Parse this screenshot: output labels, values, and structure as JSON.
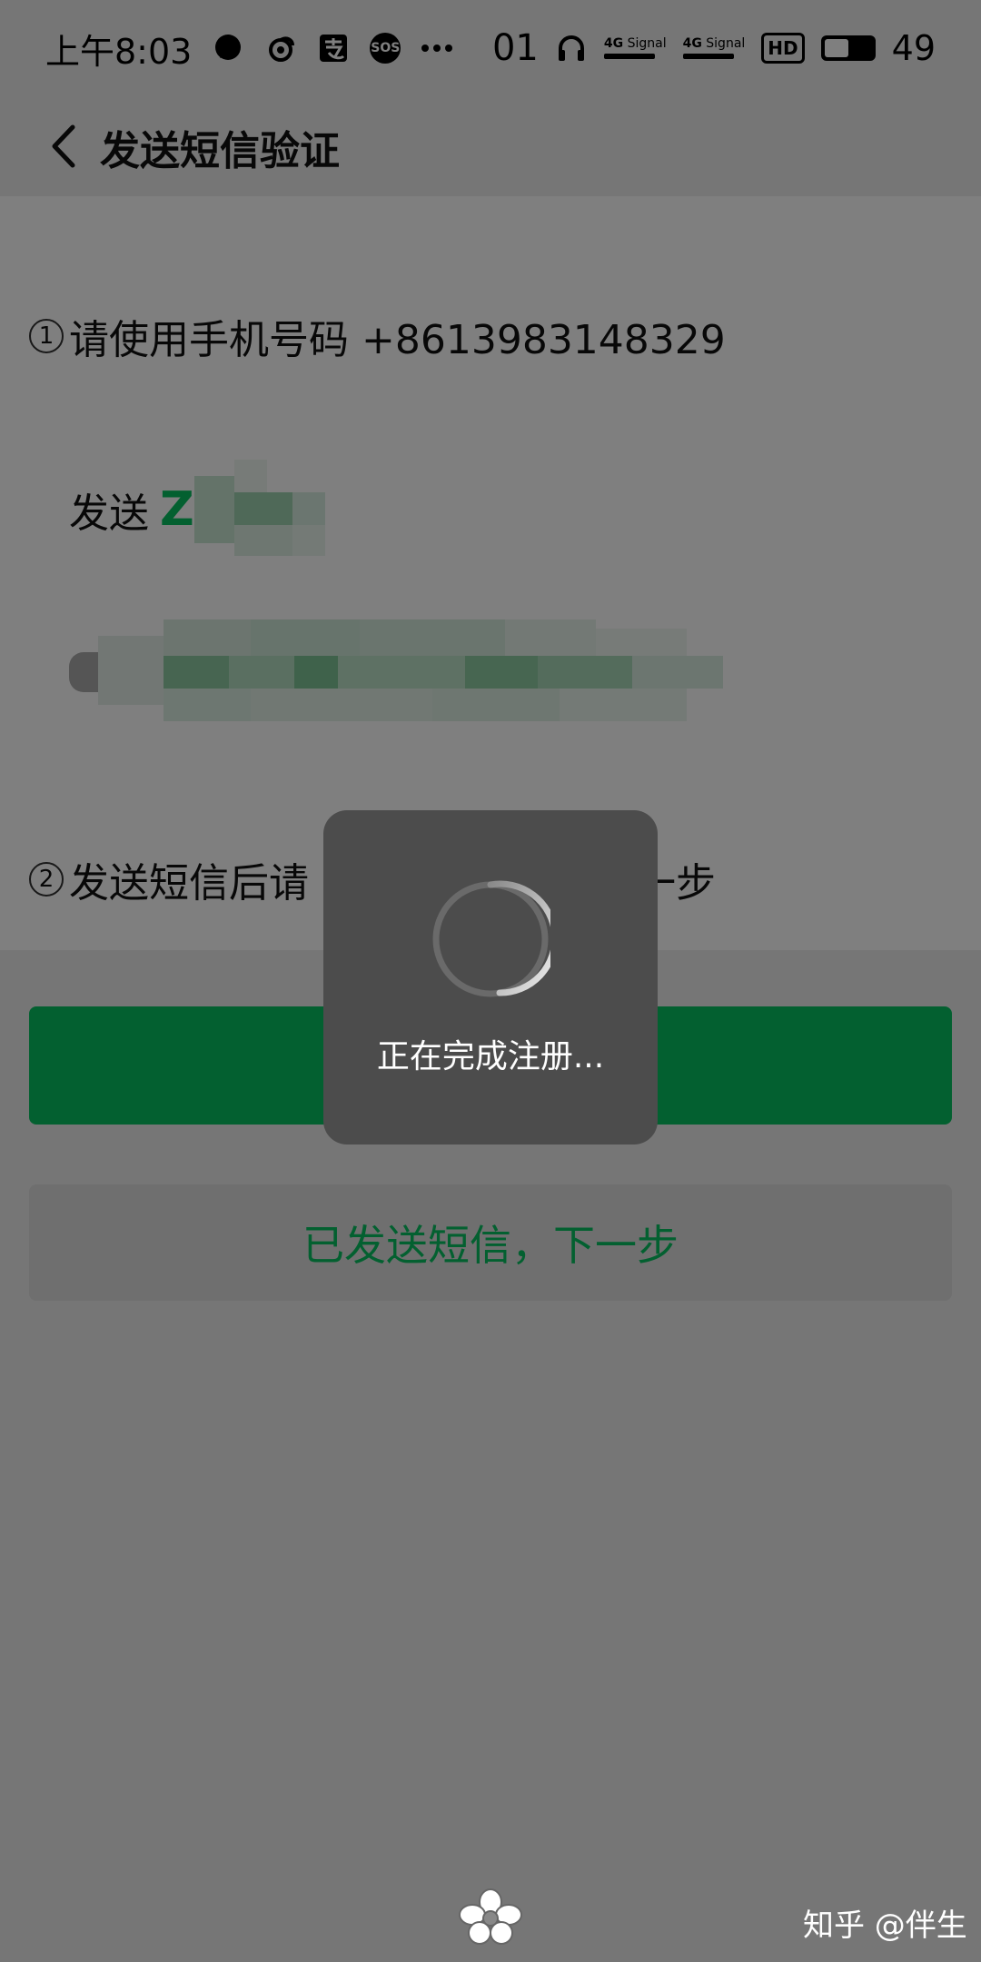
{
  "status_bar": {
    "time": "上午8:03",
    "net_speed": "01",
    "signal_1": "4G",
    "signal_1_label": "Signal",
    "signal_2": "4G",
    "signal_2_label": "Signal",
    "hd_badge": "HD",
    "battery": "49"
  },
  "header": {
    "title": "发送短信验证"
  },
  "steps": {
    "step1_num": "1",
    "step1_text": "请使用手机号码 +8613983148329",
    "send_prefix": "发送",
    "send_code_visible": "Z",
    "step2_num": "2",
    "step2_text": "发送短信后请",
    "step2_tail": "一步"
  },
  "buttons": {
    "secondary_label": "已发送短信，下一步"
  },
  "toast": {
    "message": "正在完成注册..."
  },
  "watermark": {
    "text": "知乎 @伴生"
  },
  "colors": {
    "accent": "#07c160",
    "toast_bg": "#4c4c4c"
  }
}
